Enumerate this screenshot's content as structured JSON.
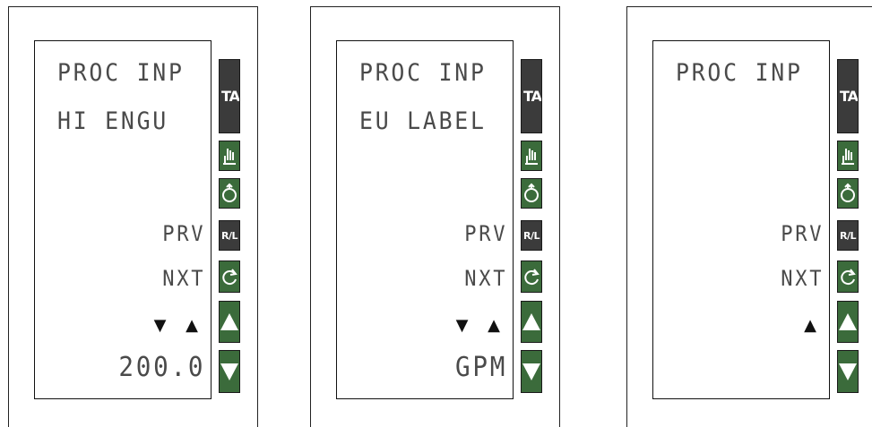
{
  "panels": [
    {
      "line1": "PROC INP",
      "line2": "HI ENGU",
      "prv": "PRV",
      "nxt": "NXT",
      "arrows": "▼ ▲",
      "value": "200.0"
    },
    {
      "line1": "PROC INP",
      "line2": "EU LABEL",
      "prv": "PRV",
      "nxt": "NXT",
      "arrows": "▼ ▲",
      "value": "GPM"
    },
    {
      "line1": "PROC INP",
      "line2": "",
      "prv": "PRV",
      "nxt": "NXT",
      "arrows": "▲",
      "value": ""
    }
  ],
  "buttons": {
    "tag_label": "TAG",
    "rl_label": "R/L",
    "icons": [
      "hand-icon",
      "tune-icon",
      "cycle-icon",
      "up-arrow-icon",
      "down-arrow-icon"
    ]
  },
  "colors": {
    "button_dark": "#3b3b3b",
    "button_green": "#3b6b3b",
    "lcd_text": "#4a4a4a"
  }
}
